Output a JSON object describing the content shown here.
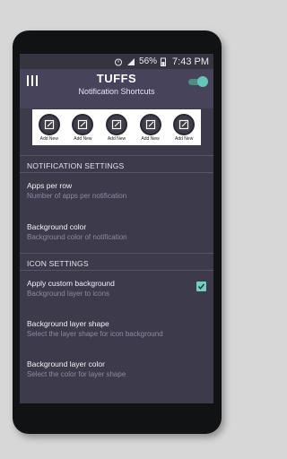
{
  "status": {
    "battery": "56%",
    "time": "7:43 PM"
  },
  "appbar": {
    "title": "TUFFS",
    "subtitle": "Notification Shortcuts",
    "toggle_on": true
  },
  "preview": {
    "slots": [
      "Add New",
      "Add New",
      "Add New",
      "Add New",
      "Add New"
    ]
  },
  "notification_settings": {
    "header": "NOTIFICATION SETTINGS",
    "apps_per_row": {
      "title": "Apps per row",
      "subtitle": "Number of apps per notification"
    },
    "background_color": {
      "title": "Background color",
      "subtitle": "Background color of notification"
    }
  },
  "icon_settings": {
    "header": "ICON SETTINGS",
    "apply_custom_background": {
      "title": "Apply custom background",
      "subtitle": "Background layer to icons",
      "checked": true
    },
    "background_layer_shape": {
      "title": "Background layer shape",
      "subtitle": "Select the layer shape for icon background"
    },
    "background_layer_color": {
      "title": "Background layer color",
      "subtitle": "Select the color for layer shape"
    }
  },
  "colors": {
    "accent": "#63c6b6",
    "appbar": "#46435b",
    "background": "#3d3a4b"
  }
}
